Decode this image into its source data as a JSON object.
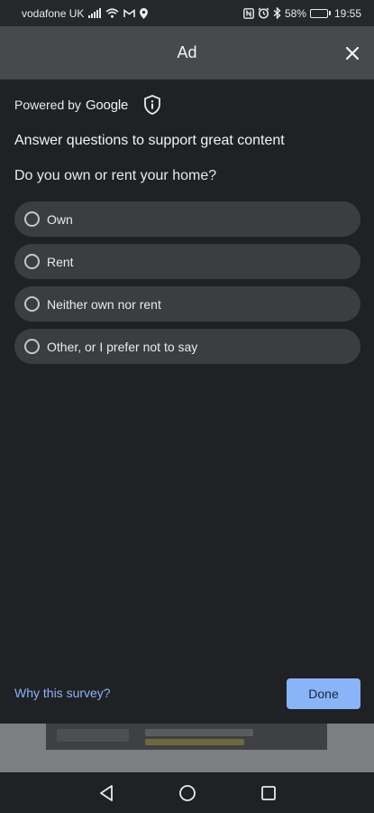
{
  "status_bar": {
    "carrier": "vodafone UK",
    "battery_percent": "58%",
    "battery_level": 0.58,
    "time": "19:55",
    "icons": [
      "signal-icon",
      "wifi-icon",
      "gmail-icon",
      "location-icon",
      "nfc-icon",
      "alarm-icon",
      "bluetooth-icon",
      "battery-icon"
    ]
  },
  "header": {
    "title": "Ad",
    "close_icon": "close-icon"
  },
  "survey": {
    "powered_by": "Powered by",
    "brand": "Google",
    "shield_icon": "info-shield-icon",
    "heading": "Answer questions to support great content",
    "question": "Do you own or rent your home?",
    "options": [
      {
        "label": "Own",
        "selected": false
      },
      {
        "label": "Rent",
        "selected": false
      },
      {
        "label": "Neither own nor rent",
        "selected": false
      },
      {
        "label": "Other, or I prefer not to say",
        "selected": false
      }
    ],
    "why_link": "Why this survey?",
    "done_label": "Done"
  },
  "colors": {
    "background": "#202124",
    "header": "#48494c",
    "option_bg": "#3c3d40",
    "accent": "#8ab4f8"
  },
  "nav_bar": {
    "icons": [
      "back-icon",
      "home-icon",
      "recents-icon"
    ]
  }
}
